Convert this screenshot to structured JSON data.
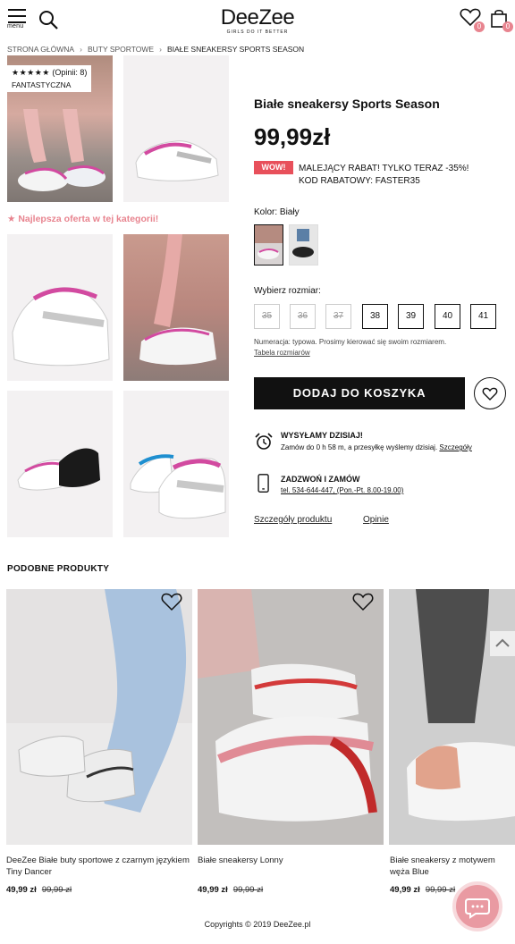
{
  "header": {
    "menu_label": "menu",
    "logo": "DeeZee",
    "logo_tagline": "GIRLS DO IT BETTER",
    "wishlist_count": "0",
    "cart_count": "0"
  },
  "breadcrumb": [
    "STRONA GŁÓWNA",
    "BUTY SPORTOWE",
    "BIAŁE SNEAKERSY SPORTS SEASON"
  ],
  "rating": {
    "stars": "★★★★★",
    "reviews": "(Opinii: 8)",
    "quality": "FANTASTYCZNA"
  },
  "best_offer": "★ Najlepsza oferta w tej kategorii!",
  "product": {
    "name": "Białe sneakersy Sports Season",
    "price": "99,99zł",
    "badge": "WOW!",
    "promo_line1": "MALEJĄCY RABAT! TYLKO TERAZ -35%!",
    "promo_line2": "KOD RABATOWY: FASTER35",
    "color_label": "Kolor: Biały",
    "size_label": "Wybierz rozmiar:",
    "sizes": [
      {
        "label": "35",
        "available": false
      },
      {
        "label": "36",
        "available": false
      },
      {
        "label": "37",
        "available": false
      },
      {
        "label": "38",
        "available": true
      },
      {
        "label": "39",
        "available": true
      },
      {
        "label": "40",
        "available": true
      },
      {
        "label": "41",
        "available": true
      }
    ],
    "size_note": "Numeracja: typowa. Prosimy kierować się swoim rozmiarem.",
    "size_table_link": "Tabela rozmiarów",
    "add_to_cart": "DODAJ DO KOSZYKA"
  },
  "shipping": {
    "title": "WYSYŁAMY DZISIAJ!",
    "text": "Zamów do 0 h 58 m, a przesyłkę wyślemy dzisiaj.",
    "link": "Szczegóły"
  },
  "call": {
    "title": "ZADZWOŃ I ZAMÓW",
    "text": "tel. 534-644-447, (Pon.-Pt. 8.00-19.00)"
  },
  "tabs": [
    "Szczegóły produktu",
    "Opinie"
  ],
  "similar": {
    "title": "PODOBNE PRODUKTY",
    "items": [
      {
        "name": "DeeZee Białe buty sportowe z czarnym językiem Tiny Dancer",
        "price": "49,99 zł",
        "old_price": "99,99 zł"
      },
      {
        "name": "Białe sneakersy Lonny",
        "price": "49,99 zł",
        "old_price": "99,99 zł"
      },
      {
        "name": "Białe sneakersy z motywem węża Blue",
        "price": "49,99 zł",
        "old_price": "99,99 zł"
      }
    ]
  },
  "footer": "Copyrights © 2019 DeeZee.pl",
  "colors": {
    "accent_pink": "#e8848f",
    "wow_red": "#e8505b",
    "button_black": "#111111"
  },
  "icons": [
    "menu-icon",
    "search-icon",
    "heart-icon",
    "bag-icon",
    "alarm-clock-icon",
    "phone-icon",
    "chevron-up-icon",
    "chat-icon"
  ]
}
